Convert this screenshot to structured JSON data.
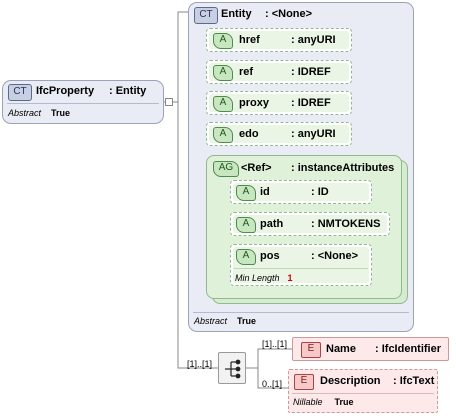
{
  "ifcproperty": {
    "badge": "CT",
    "name": "IfcProperty",
    "type": ": Entity",
    "footer_key": "Abstract",
    "footer_val": "True"
  },
  "entity": {
    "badge": "CT",
    "name": "Entity",
    "type": ": <None>",
    "footer_key": "Abstract",
    "footer_val": "True",
    "attributes": [
      {
        "badge": "A",
        "name": "href",
        "type": ": anyURI"
      },
      {
        "badge": "A",
        "name": "ref",
        "type": ": IDREF"
      },
      {
        "badge": "A",
        "name": "proxy",
        "type": ": IDREF"
      },
      {
        "badge": "A",
        "name": "edo",
        "type": ": anyURI"
      }
    ],
    "group": {
      "badge": "AG",
      "name": "<Ref>",
      "type": ": instanceAttributes",
      "attributes": [
        {
          "badge": "A",
          "name": "id",
          "type": ": ID"
        },
        {
          "badge": "A",
          "name": "path",
          "type": ": NMTOKENS"
        },
        {
          "badge": "A",
          "name": "pos",
          "type": ": <None>",
          "facet_key": "Min Length",
          "facet_val": "1"
        }
      ]
    }
  },
  "sequence": {
    "cardinality": "[1]..[1]"
  },
  "elements": [
    {
      "badge": "E",
      "name": "Name",
      "type": ": IfcIdentifier",
      "cardinality": "[1]..[1]"
    },
    {
      "badge": "E",
      "name": "Description",
      "type": ": IfcText",
      "cardinality": "0..[1]",
      "facet_key": "Nillable",
      "facet_val": "True"
    }
  ],
  "colors": {
    "complex_type": "#e9ebf5",
    "attribute": "#eaf5e6",
    "element": "#fde9e9"
  }
}
